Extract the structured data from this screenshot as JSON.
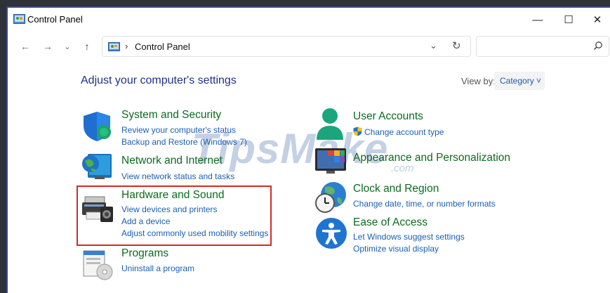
{
  "window": {
    "title": "Control Panel",
    "minimize_glyph": "—",
    "maximize_glyph": "☐",
    "close_glyph": "✕"
  },
  "nav": {
    "back_glyph": "←",
    "forward_glyph": "→",
    "recent_glyph": "⌄",
    "up_glyph": "↑",
    "address_separator": "›",
    "address_text": "Control Panel",
    "address_dropdown_glyph": "⌄",
    "refresh_glyph": "↻",
    "search_placeholder": ""
  },
  "main": {
    "heading": "Adjust your computer's settings",
    "view_by_label": "View by:",
    "view_by_value": "Category ˅"
  },
  "categories": {
    "system_security": {
      "title": "System and Security",
      "links": [
        "Review your computer's status",
        "Backup and Restore (Windows 7)"
      ]
    },
    "network_internet": {
      "title": "Network and Internet",
      "links": [
        "View network status and tasks"
      ]
    },
    "hardware_sound": {
      "title": "Hardware and Sound",
      "links": [
        "View devices and printers",
        "Add a device",
        "Adjust commonly used mobility settings"
      ]
    },
    "programs": {
      "title": "Programs",
      "links": [
        "Uninstall a program"
      ]
    },
    "user_accounts": {
      "title": "User Accounts",
      "links": [
        "Change account type"
      ]
    },
    "appearance": {
      "title": "Appearance and Personalization",
      "links": []
    },
    "clock_region": {
      "title": "Clock and Region",
      "links": [
        "Change date, time, or number formats"
      ]
    },
    "ease_access": {
      "title": "Ease of Access",
      "links": [
        "Let Windows suggest settings",
        "Optimize visual display"
      ]
    }
  },
  "watermark": {
    "text": "TipsMake",
    "suffix": ".com"
  },
  "colors": {
    "category_title": "#0b6b1e",
    "link": "#1a5fb4",
    "heading": "#1e3287",
    "highlight_border": "#d22a2a"
  }
}
